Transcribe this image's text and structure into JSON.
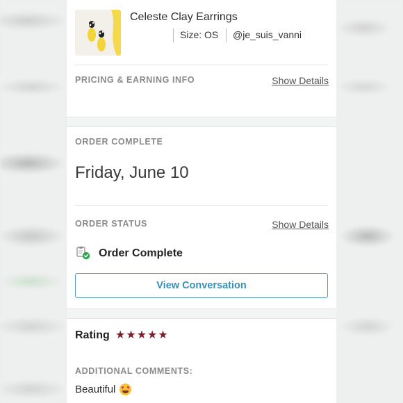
{
  "product": {
    "title": "Celeste Clay Earrings",
    "size": "Size: OS",
    "seller": "@je_suis_vanni",
    "thumbnail_icon": "earrings-thumbnail"
  },
  "pricing": {
    "label": "PRICING & EARNING INFO",
    "link": "Show Details"
  },
  "order_complete": {
    "label": "ORDER COMPLETE",
    "date": "Friday, June 10"
  },
  "order_status": {
    "label": "ORDER STATUS",
    "link": "Show Details",
    "status": "Order Complete",
    "status_icon": "check-clipboard-icon"
  },
  "view_conversation": "View Conversation",
  "rating": {
    "label": "Rating",
    "stars": 5,
    "star_color": "#7a1f2e"
  },
  "comments": {
    "label": "ADDITIONAL COMMENTS:",
    "text": "Beautiful",
    "emoji": "heart-eyes-emoji"
  },
  "colors": {
    "accent": "#3a8fb6",
    "star": "#7a1f2e",
    "success": "#2ea44f"
  }
}
